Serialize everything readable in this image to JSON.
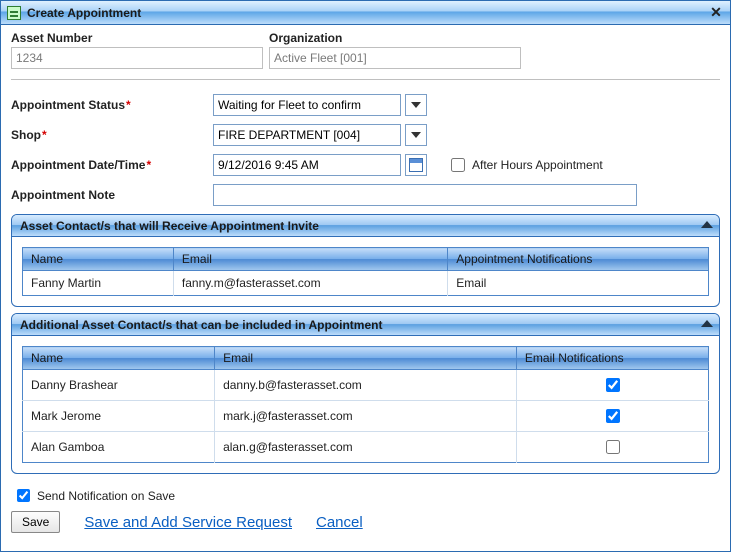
{
  "window": {
    "title": "Create Appointment"
  },
  "top": {
    "assetNumberLabel": "Asset Number",
    "organizationLabel": "Organization",
    "assetNumberValue": "1234",
    "organizationValue": "Active Fleet [001]"
  },
  "form": {
    "statusLabel": "Appointment Status",
    "statusValue": "Waiting for Fleet to confirm",
    "shopLabel": "Shop",
    "shopValue": "FIRE DEPARTMENT [004]",
    "dateLabel": "Appointment Date/Time",
    "dateValue": "9/12/2016 9:45 AM",
    "afterHoursLabel": "After Hours Appointment",
    "afterHoursChecked": false,
    "noteLabel": "Appointment Note",
    "noteValue": ""
  },
  "panels": {
    "receive": {
      "title": "Asset Contact/s that will Receive Appointment Invite",
      "cols": [
        "Name",
        "Email",
        "Appointment Notifications"
      ],
      "rows": [
        {
          "name": "Fanny Martin",
          "email": "fanny.m@fasterasset.com",
          "notif": "Email"
        }
      ]
    },
    "additional": {
      "title": "Additional Asset Contact/s that can be included in Appointment",
      "cols": [
        "Name",
        "Email",
        "Email Notifications"
      ],
      "rows": [
        {
          "name": "Danny Brashear",
          "email": "danny.b@fasterasset.com",
          "checked": true
        },
        {
          "name": "Mark Jerome",
          "email": "mark.j@fasterasset.com",
          "checked": true
        },
        {
          "name": "Alan Gamboa",
          "email": "alan.g@fasterasset.com",
          "checked": false
        }
      ]
    }
  },
  "footer": {
    "sendNotificationLabel": "Send Notification on Save",
    "sendNotificationChecked": true,
    "saveLabel": "Save",
    "saveAddLabel": "Save and Add Service Request",
    "cancelLabel": "Cancel"
  }
}
